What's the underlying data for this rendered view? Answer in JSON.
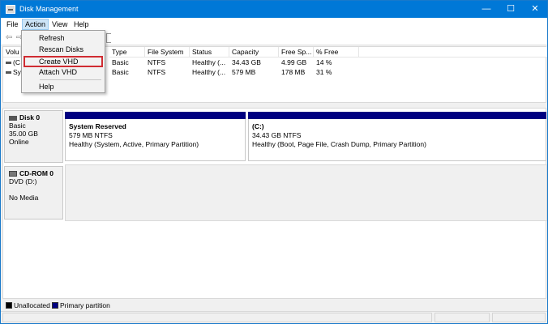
{
  "window": {
    "title": "Disk Management",
    "controls": {
      "minimize": "—",
      "maximize": "☐",
      "close": "✕"
    }
  },
  "menu": {
    "file": "File",
    "action": "Action",
    "view": "View",
    "help": "Help"
  },
  "toolbar": {
    "back": "⇦",
    "forward": "⇨"
  },
  "action_menu": {
    "items": [
      "Refresh",
      "Rescan Disks",
      "Create VHD",
      "Attach VHD",
      "Help"
    ],
    "highlighted": "Create VHD"
  },
  "volume_list": {
    "columns": [
      "Volu",
      "Type",
      "File System",
      "Status",
      "Capacity",
      "Free Sp...",
      "% Free"
    ],
    "rows": [
      {
        "volume": "(C",
        "type": "Basic",
        "fs": "NTFS",
        "status": "Healthy (...",
        "capacity": "34.43 GB",
        "free": "4.99 GB",
        "pct": "14 %"
      },
      {
        "volume": "Sys",
        "type": "Basic",
        "fs": "NTFS",
        "status": "Healthy (...",
        "capacity": "579 MB",
        "free": "178 MB",
        "pct": "31 %"
      }
    ]
  },
  "disks": [
    {
      "name": "Disk 0",
      "type": "Basic",
      "size": "35.00 GB",
      "state": "Online",
      "partitions": [
        {
          "name": "System Reserved",
          "size": "579 MB NTFS",
          "status": "Healthy (System, Active, Primary Partition)"
        },
        {
          "name": "(C:)",
          "size": "34.43 GB NTFS",
          "status": "Healthy (Boot, Page File, Crash Dump, Primary Partition)"
        }
      ]
    },
    {
      "name": "CD-ROM 0",
      "type": "DVD (D:)",
      "media": "No Media"
    }
  ],
  "legend": {
    "unallocated": "Unallocated",
    "primary": "Primary partition",
    "unallocated_color": "#000000",
    "primary_color": "#000080"
  },
  "colors": {
    "titlebar": "#0078d7",
    "partition_bar": "#000080",
    "highlight_box": "#d02c32"
  }
}
